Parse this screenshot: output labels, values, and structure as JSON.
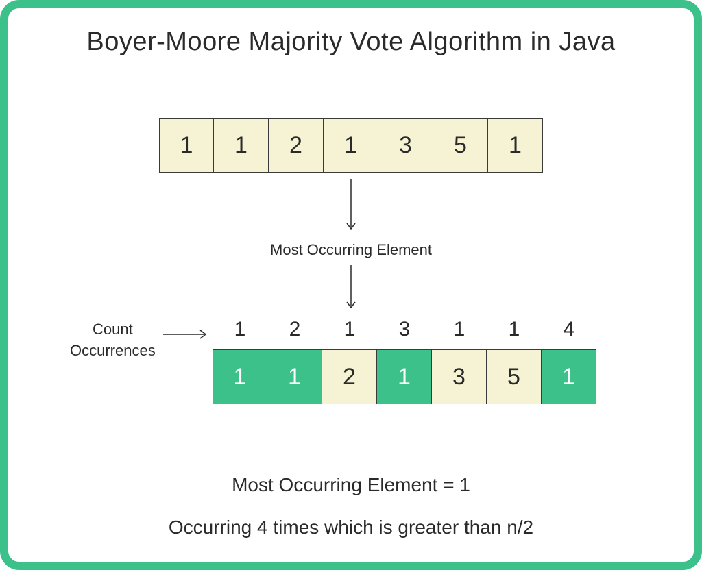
{
  "title": "Boyer-Moore Majority Vote Algorithm in Java",
  "array1": [
    "1",
    "1",
    "2",
    "1",
    "3",
    "5",
    "1"
  ],
  "midLabel": "Most Occurring Element",
  "sideLabel": "Count\nOccurrences",
  "counts": [
    "1",
    "2",
    "1",
    "3",
    "1",
    "1",
    "4"
  ],
  "array2": [
    {
      "v": "1",
      "hl": true
    },
    {
      "v": "1",
      "hl": true
    },
    {
      "v": "2",
      "hl": false
    },
    {
      "v": "1",
      "hl": true
    },
    {
      "v": "3",
      "hl": false
    },
    {
      "v": "5",
      "hl": false
    },
    {
      "v": "1",
      "hl": true
    }
  ],
  "result1": "Most Occurring Element = 1",
  "result2": "Occurring 4 times which is  greater than  n/2",
  "colors": {
    "accent": "#3cc18a",
    "cream": "#f5f3d4",
    "text": "#2a2a2a"
  }
}
